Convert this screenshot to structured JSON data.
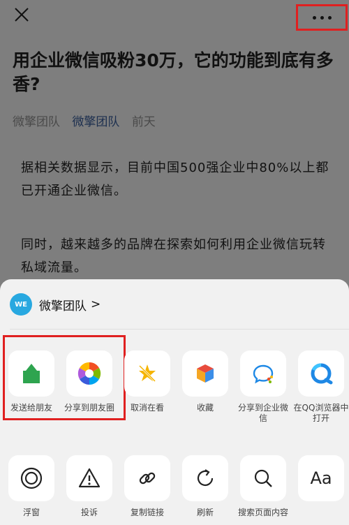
{
  "article": {
    "title": "用企业微信吸粉30万，它的功能到底有多香?",
    "source": "微擎团队",
    "account": "微擎团队",
    "date": "前天",
    "paragraph1": "据相关数据显示，目前中国500强企业中80%以上都已开通企业微信。",
    "paragraph2": "同时，越来越多的品牌在探索如何利用企业微信玩转私域流量。"
  },
  "sheet": {
    "account_name": "微擎团队",
    "account_logo_text": "WE",
    "row1": [
      {
        "label": "发送给朋友",
        "icon": "send-to-friend-icon"
      },
      {
        "label": "分享到朋友圈",
        "icon": "moments-icon"
      },
      {
        "label": "取消在看",
        "icon": "cancel-wow-icon"
      },
      {
        "label": "收藏",
        "icon": "favorite-icon"
      },
      {
        "label": "分享到企业微信",
        "icon": "wecom-icon"
      },
      {
        "label": "在QQ浏览器中打开",
        "icon": "qq-browser-icon"
      }
    ],
    "row2": [
      {
        "label": "浮窗",
        "icon": "float-window-icon"
      },
      {
        "label": "投诉",
        "icon": "complaint-icon"
      },
      {
        "label": "复制链接",
        "icon": "copy-link-icon"
      },
      {
        "label": "刷新",
        "icon": "refresh-icon"
      },
      {
        "label": "搜索页面内容",
        "icon": "search-icon"
      },
      {
        "label": "Aa",
        "icon": "font-size-icon"
      }
    ]
  },
  "colors": {
    "highlight": "#e02020",
    "share_green": "#2ea44f",
    "wecom_blue": "#1e88e5"
  }
}
